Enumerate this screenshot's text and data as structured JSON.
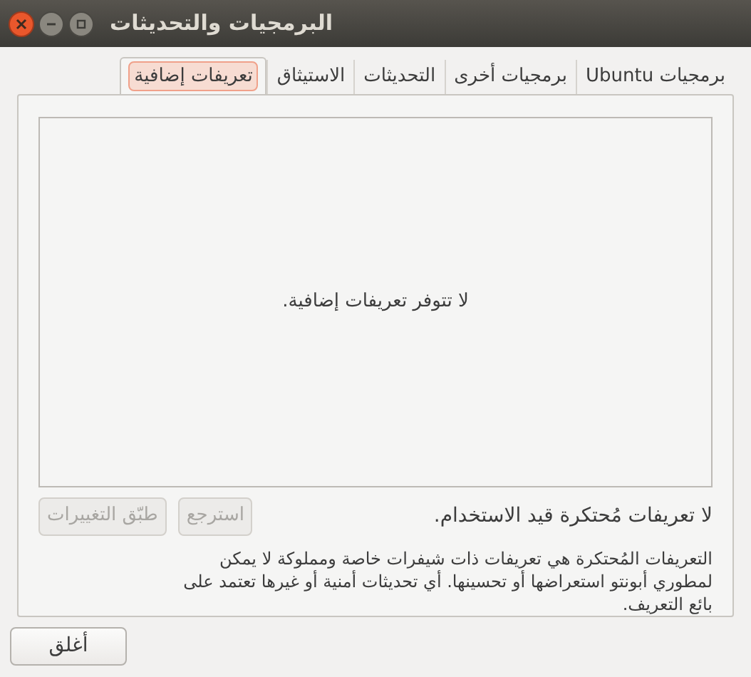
{
  "window": {
    "title": "البرمجيات والتحديثات"
  },
  "tabs": [
    {
      "label": "برمجيات Ubuntu",
      "selected": false
    },
    {
      "label": "برمجيات أخرى",
      "selected": false
    },
    {
      "label": "التحديثات",
      "selected": false
    },
    {
      "label": "الاستيثاق",
      "selected": false
    },
    {
      "label": "تعريفات إضافية",
      "selected": true
    }
  ],
  "driver_list": {
    "empty_message": "لا تتوفر تعريفات إضافية."
  },
  "status": "لا تعريفات مُحتكرة قيد الاستخدام.",
  "buttons": [
    {
      "label": "استرجع",
      "disabled": true
    },
    {
      "label": "طبّق التغييرات",
      "disabled": true
    }
  ],
  "description": "التعريفات المُحتكرة هي تعريفات ذات شيفرات خاصة ومملوكة لا يمكن لمطوري أبونتو استعراضها أو تحسينها. أي تحديثات أمنية أو غيرها تعتمد على بائع التعريف.",
  "close_button": "أغلق"
}
